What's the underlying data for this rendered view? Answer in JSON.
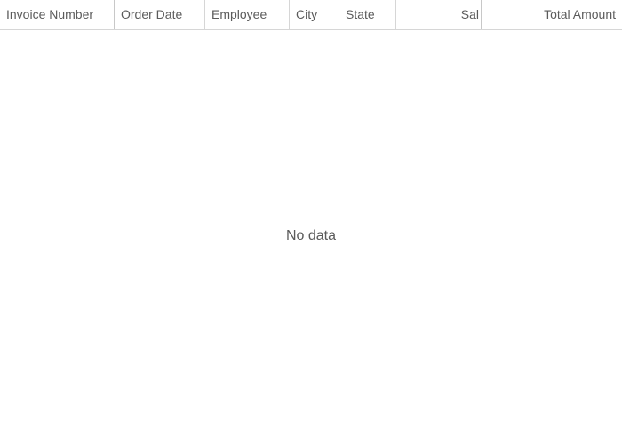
{
  "columns": [
    {
      "label": "Invoice Number"
    },
    {
      "label": "Order Date"
    },
    {
      "label": "Employee"
    },
    {
      "label": "City"
    },
    {
      "label": "State"
    },
    {
      "label": "Sal"
    },
    {
      "label": "Total Amount"
    }
  ],
  "empty_message": "No data"
}
